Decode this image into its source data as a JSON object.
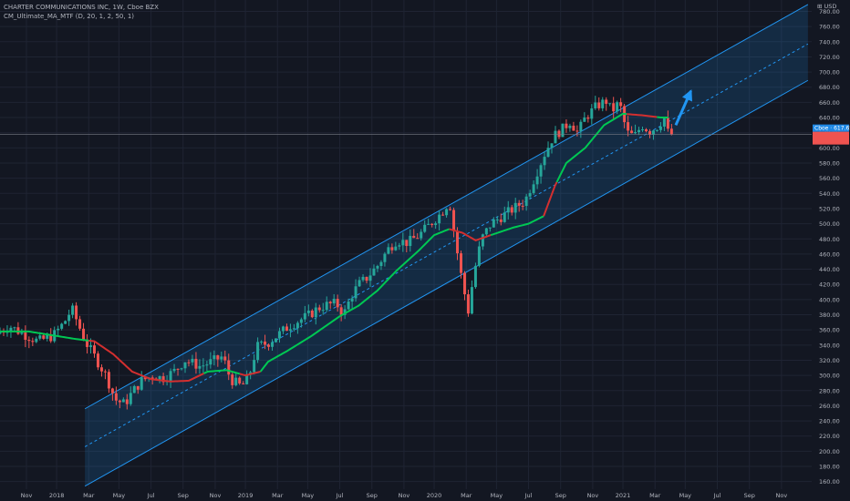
{
  "header": {
    "title": "CHARTER COMMUNICATIONS INC, 1W, Cboe BZX",
    "indicator": "CM_Ultimate_MA_MTF (D, 20, 1, 2, 50, 1)"
  },
  "colors": {
    "background": "#131722",
    "bull": "#26a69a",
    "bear": "#ef5350",
    "ma_up": "#00c853",
    "ma_down": "#d32f2f",
    "channel": "#2196f3",
    "arrow": "#2196f3",
    "price_tag": "#1e88e5"
  },
  "chart_data": {
    "type": "candlestick",
    "currency": "USD",
    "ylim": [
      150,
      795
    ],
    "yticks": [
      160,
      180,
      200,
      220,
      240,
      260,
      280,
      300,
      320,
      340,
      360,
      380,
      400,
      420,
      440,
      460,
      480,
      500,
      520,
      540,
      560,
      580,
      600,
      620,
      640,
      660,
      680,
      700,
      720,
      740,
      760,
      780
    ],
    "xticks": [
      {
        "label": "Nov",
        "t": 2017.84
      },
      {
        "label": "2018",
        "t": 2018.0
      },
      {
        "label": "Mar",
        "t": 2018.17
      },
      {
        "label": "May",
        "t": 2018.33
      },
      {
        "label": "Jul",
        "t": 2018.5
      },
      {
        "label": "Sep",
        "t": 2018.67
      },
      {
        "label": "Nov",
        "t": 2018.84
      },
      {
        "label": "2019",
        "t": 2019.0
      },
      {
        "label": "Mar",
        "t": 2019.17
      },
      {
        "label": "May",
        "t": 2019.33
      },
      {
        "label": "Jul",
        "t": 2019.5
      },
      {
        "label": "Sep",
        "t": 2019.67
      },
      {
        "label": "Nov",
        "t": 2019.84
      },
      {
        "label": "2020",
        "t": 2020.0
      },
      {
        "label": "Mar",
        "t": 2020.17
      },
      {
        "label": "May",
        "t": 2020.33
      },
      {
        "label": "Jul",
        "t": 2020.5
      },
      {
        "label": "Sep",
        "t": 2020.67
      },
      {
        "label": "Nov",
        "t": 2020.84
      },
      {
        "label": "2021",
        "t": 2021.0
      },
      {
        "label": "Mar",
        "t": 2021.17
      },
      {
        "label": "May",
        "t": 2021.33
      },
      {
        "label": "Jul",
        "t": 2021.5
      },
      {
        "label": "Sep",
        "t": 2021.67
      },
      {
        "label": "Nov",
        "t": 2021.84
      }
    ],
    "last_price_label": "Cboe · 617.65",
    "last_price": 617.65,
    "price_path": [
      [
        2017.7,
        355
      ],
      [
        2017.77,
        365
      ],
      [
        2017.84,
        355
      ],
      [
        2017.92,
        345
      ],
      [
        2018.0,
        352
      ],
      [
        2018.06,
        370
      ],
      [
        2018.1,
        388
      ],
      [
        2018.13,
        370
      ],
      [
        2018.17,
        345
      ],
      [
        2018.22,
        325
      ],
      [
        2018.28,
        300
      ],
      [
        2018.33,
        268
      ],
      [
        2018.38,
        262
      ],
      [
        2018.42,
        278
      ],
      [
        2018.47,
        293
      ],
      [
        2018.53,
        300
      ],
      [
        2018.58,
        296
      ],
      [
        2018.64,
        305
      ],
      [
        2018.7,
        320
      ],
      [
        2018.78,
        312
      ],
      [
        2018.84,
        318
      ],
      [
        2018.9,
        325
      ],
      [
        2018.94,
        295
      ],
      [
        2019.0,
        285
      ],
      [
        2019.04,
        300
      ],
      [
        2019.08,
        338
      ],
      [
        2019.14,
        343
      ],
      [
        2019.2,
        355
      ],
      [
        2019.25,
        365
      ],
      [
        2019.3,
        372
      ],
      [
        2019.36,
        380
      ],
      [
        2019.4,
        388
      ],
      [
        2019.45,
        393
      ],
      [
        2019.5,
        395
      ],
      [
        2019.54,
        380
      ],
      [
        2019.58,
        405
      ],
      [
        2019.62,
        420
      ],
      [
        2019.66,
        428
      ],
      [
        2019.72,
        445
      ],
      [
        2019.78,
        468
      ],
      [
        2019.82,
        478
      ],
      [
        2019.88,
        475
      ],
      [
        2019.94,
        485
      ],
      [
        2020.0,
        500
      ],
      [
        2020.06,
        515
      ],
      [
        2020.1,
        530
      ],
      [
        2020.13,
        480
      ],
      [
        2020.17,
        420
      ],
      [
        2020.2,
        385
      ],
      [
        2020.23,
        435
      ],
      [
        2020.27,
        480
      ],
      [
        2020.32,
        500
      ],
      [
        2020.38,
        510
      ],
      [
        2020.44,
        520
      ],
      [
        2020.5,
        530
      ],
      [
        2020.55,
        560
      ],
      [
        2020.6,
        590
      ],
      [
        2020.65,
        615
      ],
      [
        2020.7,
        625
      ],
      [
        2020.74,
        635
      ],
      [
        2020.78,
        620
      ],
      [
        2020.82,
        640
      ],
      [
        2020.88,
        655
      ],
      [
        2020.93,
        662
      ],
      [
        2020.96,
        648
      ],
      [
        2021.0,
        660
      ],
      [
        2021.04,
        620
      ],
      [
        2021.08,
        615
      ],
      [
        2021.12,
        630
      ],
      [
        2021.16,
        622
      ],
      [
        2021.2,
        628
      ],
      [
        2021.24,
        640
      ],
      [
        2021.26,
        618
      ]
    ],
    "ma_path": [
      [
        2017.7,
        358
      ],
      [
        2017.85,
        358
      ],
      [
        2018.0,
        352
      ],
      [
        2018.1,
        348
      ],
      [
        2018.2,
        345
      ],
      [
        2018.3,
        328
      ],
      [
        2018.4,
        305
      ],
      [
        2018.5,
        295
      ],
      [
        2018.6,
        292
      ],
      [
        2018.7,
        293
      ],
      [
        2018.8,
        305
      ],
      [
        2018.9,
        307
      ],
      [
        2019.0,
        300
      ],
      [
        2019.08,
        305
      ],
      [
        2019.12,
        318
      ],
      [
        2019.22,
        332
      ],
      [
        2019.35,
        352
      ],
      [
        2019.5,
        378
      ],
      [
        2019.6,
        392
      ],
      [
        2019.7,
        412
      ],
      [
        2019.8,
        438
      ],
      [
        2019.92,
        465
      ],
      [
        2020.0,
        485
      ],
      [
        2020.08,
        493
      ],
      [
        2020.15,
        488
      ],
      [
        2020.22,
        478
      ],
      [
        2020.3,
        485
      ],
      [
        2020.42,
        495
      ],
      [
        2020.5,
        500
      ],
      [
        2020.58,
        510
      ],
      [
        2020.64,
        550
      ],
      [
        2020.7,
        580
      ],
      [
        2020.8,
        600
      ],
      [
        2020.9,
        630
      ],
      [
        2021.0,
        645
      ],
      [
        2021.1,
        643
      ],
      [
        2021.2,
        640
      ],
      [
        2021.24,
        640
      ]
    ],
    "ma_segments_color": [
      {
        "from": 2017.7,
        "to": 2018.17,
        "trend": "up"
      },
      {
        "from": 2018.17,
        "to": 2018.78,
        "trend": "down"
      },
      {
        "from": 2018.78,
        "to": 2018.97,
        "trend": "up"
      },
      {
        "from": 2018.97,
        "to": 2019.08,
        "trend": "down"
      },
      {
        "from": 2019.08,
        "to": 2020.08,
        "trend": "up"
      },
      {
        "from": 2020.08,
        "to": 2020.3,
        "trend": "down"
      },
      {
        "from": 2020.3,
        "to": 2020.58,
        "trend": "up"
      },
      {
        "from": 2020.58,
        "to": 2020.65,
        "trend": "down"
      },
      {
        "from": 2020.65,
        "to": 2021.02,
        "trend": "up"
      },
      {
        "from": 2021.02,
        "to": 2021.18,
        "trend": "down"
      },
      {
        "from": 2021.18,
        "to": 2021.24,
        "trend": "up"
      }
    ],
    "channel": {
      "t_start": 2018.15,
      "t_end": 2021.98,
      "upper": [
        256,
        789
      ],
      "middle": [
        206,
        737
      ],
      "lower": [
        154,
        689
      ]
    },
    "arrow": {
      "t_from": 2021.28,
      "v_from": 630,
      "t_to": 2021.36,
      "v_to": 675
    },
    "grid": true,
    "legend": "none"
  }
}
